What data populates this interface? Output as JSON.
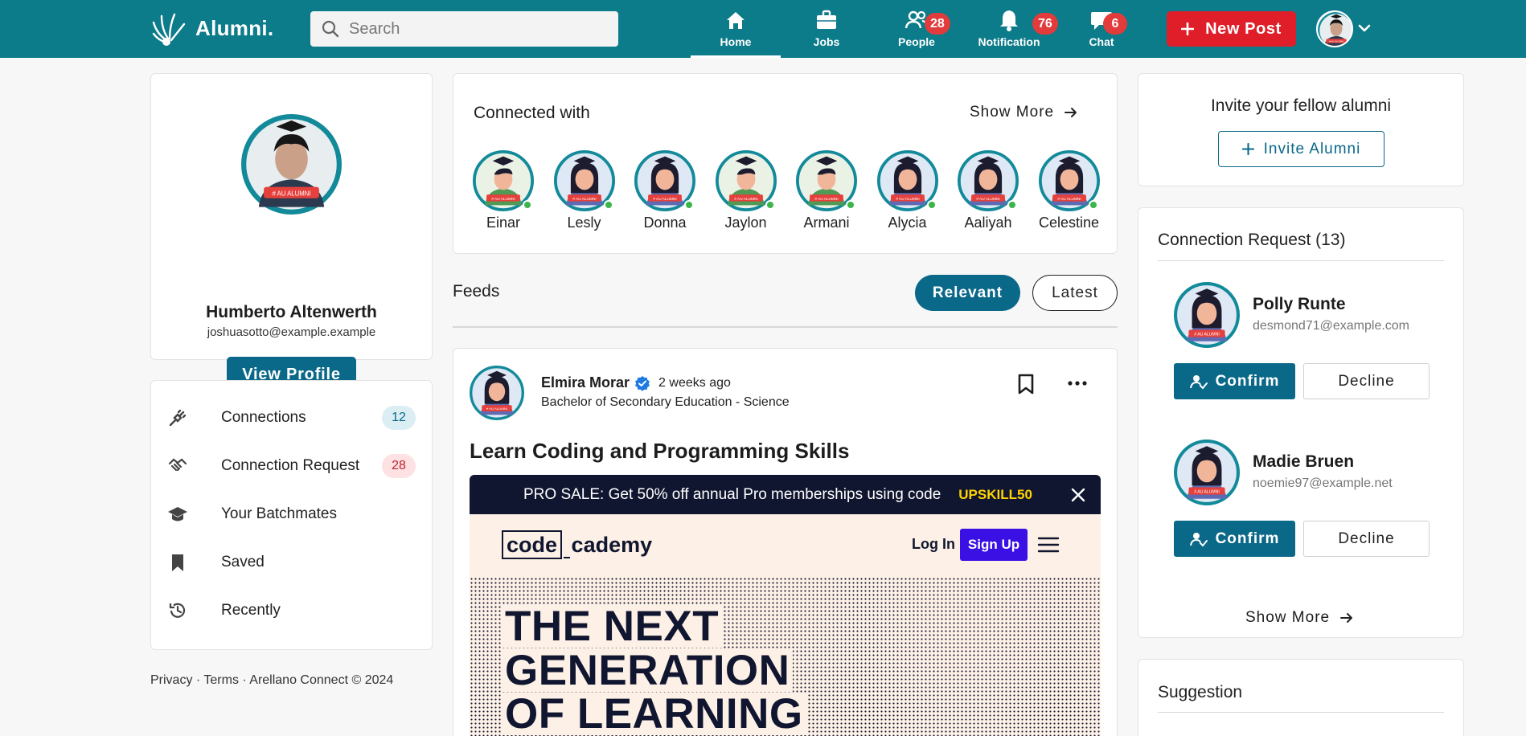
{
  "app": {
    "name": "Alumni.",
    "search_placeholder": "Search"
  },
  "nav": {
    "items": [
      {
        "label": "Home",
        "icon": "home-icon",
        "active": true
      },
      {
        "label": "Jobs",
        "icon": "briefcase-icon"
      },
      {
        "label": "People",
        "icon": "people-icon",
        "badge": "28"
      },
      {
        "label": "Notification",
        "icon": "bell-icon",
        "badge": "76"
      },
      {
        "label": "Chat",
        "icon": "chat-icon",
        "badge": "6"
      }
    ],
    "new_post_label": "New Post"
  },
  "profile": {
    "name": "Humberto Altenwerth",
    "email": "joshuasotto@example.example",
    "view_profile_label": "View Profile"
  },
  "menu": {
    "items": [
      {
        "label": "Connections",
        "badge": "12",
        "icon": "plug-icon"
      },
      {
        "label": "Connection Request",
        "badge": "28",
        "icon": "handshake-icon"
      },
      {
        "label": "Your Batchmates",
        "icon": "graduation-cap-icon"
      },
      {
        "label": "Saved",
        "icon": "bookmark-icon"
      },
      {
        "label": "Recently",
        "icon": "history-icon"
      }
    ]
  },
  "footer": {
    "text": "Privacy · Terms · Arellano Connect © 2024"
  },
  "connected": {
    "title": "Connected with",
    "show_more": "Show More",
    "people": [
      "Einar",
      "Lesly",
      "Donna",
      "Jaylon",
      "Armani",
      "Alycia",
      "Aaliyah",
      "Celestine"
    ]
  },
  "feeds": {
    "title": "Feeds",
    "relevant_label": "Relevant",
    "latest_label": "Latest"
  },
  "post": {
    "author": "Elmira Morar",
    "time": "2 weeks ago",
    "degree": "Bachelor of Secondary Education - Science",
    "title": "Learn Coding and Programming Skills",
    "promo_text": "PRO SALE: Get 50% off annual Pro memberships using code",
    "promo_code": "UPSKILL50",
    "brand_part1": "code",
    "brand_part2": "cademy",
    "login_label": "Log In",
    "signup_label": "Sign Up",
    "hero_lines": [
      "THE NEXT",
      "GENERATION",
      "OF LEARNING"
    ]
  },
  "invite": {
    "title": "Invite your fellow alumni",
    "button_label": "Invite Alumni"
  },
  "requests": {
    "title": "Connection Request (13)",
    "items": [
      {
        "name": "Polly Runte",
        "email": "desmond71@example.com"
      },
      {
        "name": "Madie Bruen",
        "email": "noemie97@example.net"
      }
    ],
    "confirm_label": "Confirm",
    "decline_label": "Decline",
    "show_more": "Show More"
  },
  "suggestion": {
    "title": "Suggestion"
  },
  "avatar_badge_text": "# AU ALUMNI",
  "colors": {
    "topbar": "#0c7b8a",
    "primary": "#0a6888",
    "danger": "#e01e2a"
  }
}
